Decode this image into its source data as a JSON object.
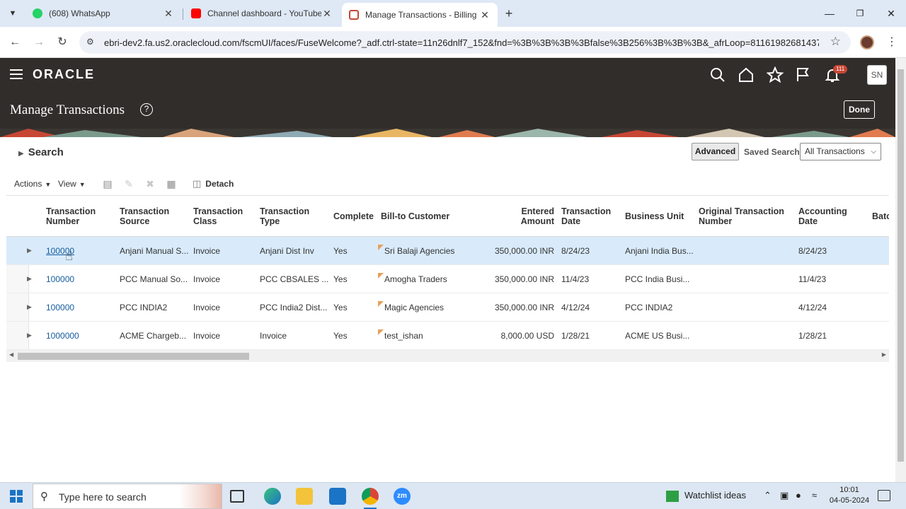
{
  "browser": {
    "tabs": [
      {
        "title": "(608) WhatsApp",
        "icon": "whatsapp-icon",
        "color": "#25d366"
      },
      {
        "title": "Channel dashboard - YouTube",
        "icon": "youtube-icon",
        "color": "#ff0000"
      },
      {
        "title": "Manage Transactions - Billing - ",
        "icon": "oracle-icon",
        "color": "#c74634",
        "active": true
      }
    ],
    "url": "ebri-dev2.fa.us2.oraclecloud.com/fscmUI/faces/FuseWelcome?_adf.ctrl-state=11n26dnlf7_152&fnd=%3B%3B%3B%3Bfalse%3B256%3B%3B%3B&_afrLoop=8116198268143787"
  },
  "app": {
    "logo": "ORACLE",
    "notification_count": "111",
    "user_initials": "SN",
    "page_title": "Manage Transactions",
    "help": "?",
    "done_label": "Done"
  },
  "search": {
    "label": "Search",
    "advanced_label": "Advanced",
    "saved_search_label": "Saved Search",
    "saved_search_value": "All Transactions"
  },
  "toolbar": {
    "actions_label": "Actions",
    "view_label": "View",
    "detach_label": "Detach"
  },
  "table": {
    "columns": [
      "Transaction Number",
      "Transaction Source",
      "Transaction Class",
      "Transaction Type",
      "Complete",
      "Bill-to Customer",
      "Entered Amount",
      "Transaction Date",
      "Business Unit",
      "Original Transaction Number",
      "Accounting Date",
      "Batc"
    ],
    "rows": [
      {
        "number": "100000",
        "source": "Anjani Manual S...",
        "class": "Invoice",
        "type": "Anjani Dist Inv",
        "complete": "Yes",
        "customer": "Sri Balaji Agencies",
        "amount": "350,000.00 INR",
        "date": "8/24/23",
        "bu": "Anjani India Bus...",
        "orig": "",
        "acct_date": "8/24/23"
      },
      {
        "number": "100000",
        "source": "PCC Manual So...",
        "class": "Invoice",
        "type": "PCC CBSALES ...",
        "complete": "Yes",
        "customer": "Amogha Traders",
        "amount": "350,000.00 INR",
        "date": "11/4/23",
        "bu": "PCC India Busi...",
        "orig": "",
        "acct_date": "11/4/23"
      },
      {
        "number": "100000",
        "source": "PCC INDIA2",
        "class": "Invoice",
        "type": "PCC India2 Dist...",
        "complete": "Yes",
        "customer": "Magic Agencies",
        "amount": "350,000.00 INR",
        "date": "4/12/24",
        "bu": "PCC INDIA2",
        "orig": "",
        "acct_date": "4/12/24"
      },
      {
        "number": "1000000",
        "source": "ACME Chargeb...",
        "class": "Invoice",
        "type": "Invoice",
        "complete": "Yes",
        "customer": "test_ishan",
        "amount": "8,000.00 USD",
        "date": "1/28/21",
        "bu": "ACME US Busi...",
        "orig": "",
        "acct_date": "1/28/21"
      }
    ]
  },
  "taskbar": {
    "search_placeholder": "Type here to search",
    "widget_label": "Watchlist ideas",
    "time": "10:01",
    "date": "04-05-2024"
  },
  "colors": {
    "header_bg": "#312d2a",
    "link": "#145c9e",
    "selected_row": "#d9ebfb",
    "accent": "#c74634"
  }
}
